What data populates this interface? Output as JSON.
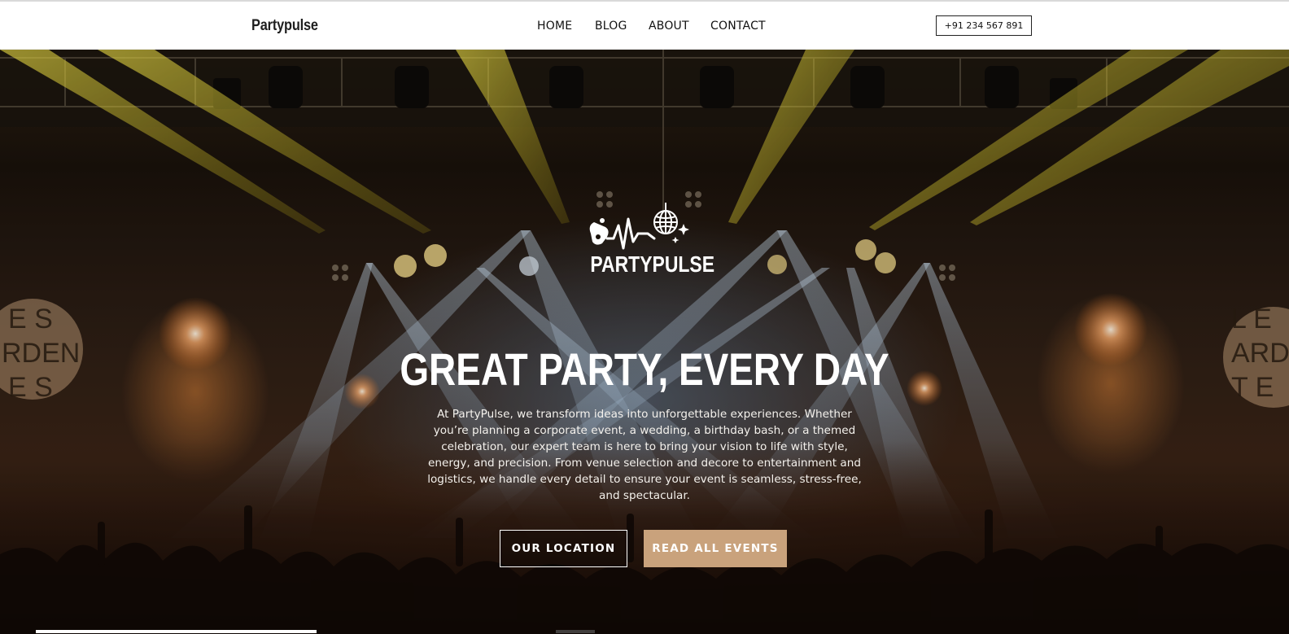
{
  "nav": {
    "brand": "Partypulse",
    "links": [
      "HOME",
      "BLOG",
      "ABOUT",
      "CONTACT"
    ],
    "phone": "+91 234 567 891"
  },
  "hero": {
    "logo_text": "PARTYPULSE",
    "logo_icon": "party-heartbeat-disco-icon",
    "headline": "GREAT PARTY, EVERY DAY",
    "intro": "At PartyPulse, we transform ideas into unforgettable experiences. Whether you’re planning a corporate event, a wedding, a birthday bash, or a themed celebration, our expert team is here to bring your vision to life with style, energy, and precision. From venue selection and decore to entertainment and logistics, we handle every detail to ensure your event is seamless, stress-free, and spectacular.",
    "btn_location": "OUR LOCATION",
    "btn_events": "READ ALL EVENTS",
    "background_image": "concert-stage-lights-crowd"
  },
  "colors": {
    "accent": "#c9a27c",
    "nav_bg": "#ffffff",
    "text_dark": "#111111"
  }
}
